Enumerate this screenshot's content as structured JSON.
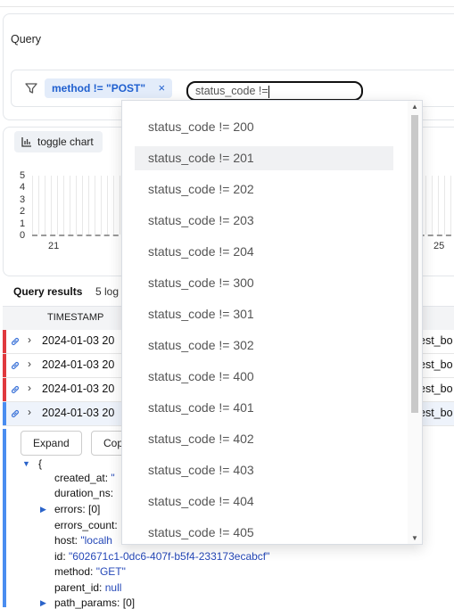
{
  "query": {
    "title": "Query",
    "chip_label": "method != \"POST\"",
    "chip_close": "×",
    "input_value": "status_code !="
  },
  "chart": {
    "toggle_label": "toggle chart"
  },
  "chart_data": {
    "type": "bar",
    "y_ticks": [
      "5",
      "4",
      "3",
      "2",
      "1",
      "0"
    ],
    "x_ticks": [
      "21",
      "25"
    ],
    "ylim": [
      0,
      5
    ]
  },
  "results": {
    "title": "Query results",
    "count": "5  log",
    "column_timestamp": "TIMESTAMP",
    "rows": [
      {
        "ts": "2024-01-03 20",
        "tail": "est_bo",
        "flag": "#e0393e"
      },
      {
        "ts": "2024-01-03 20",
        "tail": "est_bo",
        "flag": "#e0393e"
      },
      {
        "ts": "2024-01-03 20",
        "tail": "est_bo",
        "flag": "#e0393e"
      },
      {
        "ts": "2024-01-03 20",
        "tail": "est_bo",
        "flag": "#4a8df0"
      }
    ]
  },
  "detail": {
    "expand_label": "Expand",
    "copy_label": "Cop",
    "brace": "{",
    "created_at_key": "created_at:",
    "created_at_val": "\"",
    "duration_key": "duration_ns:",
    "errors_key": "errors:",
    "errors_val": "[0]",
    "errors_count_key": "errors_count:",
    "host_key": "host:",
    "host_val": "\"localh",
    "id_key": "id:",
    "id_val": "\"602671c1-0dc6-407f-b5f4-233173ecabcf\"",
    "method_key": "method:",
    "method_val": "\"GET\"",
    "parent_key": "parent_id:",
    "parent_val": "null",
    "path_key": "path_params:",
    "path_val": "[0]"
  },
  "dropdown": {
    "options": [
      "status_code != 200",
      "status_code != 201",
      "status_code != 202",
      "status_code != 203",
      "status_code != 204",
      "status_code != 300",
      "status_code != 301",
      "status_code != 302",
      "status_code != 400",
      "status_code != 401",
      "status_code != 402",
      "status_code != 403",
      "status_code != 404",
      "status_code != 405"
    ],
    "highlighted_index": 1
  }
}
